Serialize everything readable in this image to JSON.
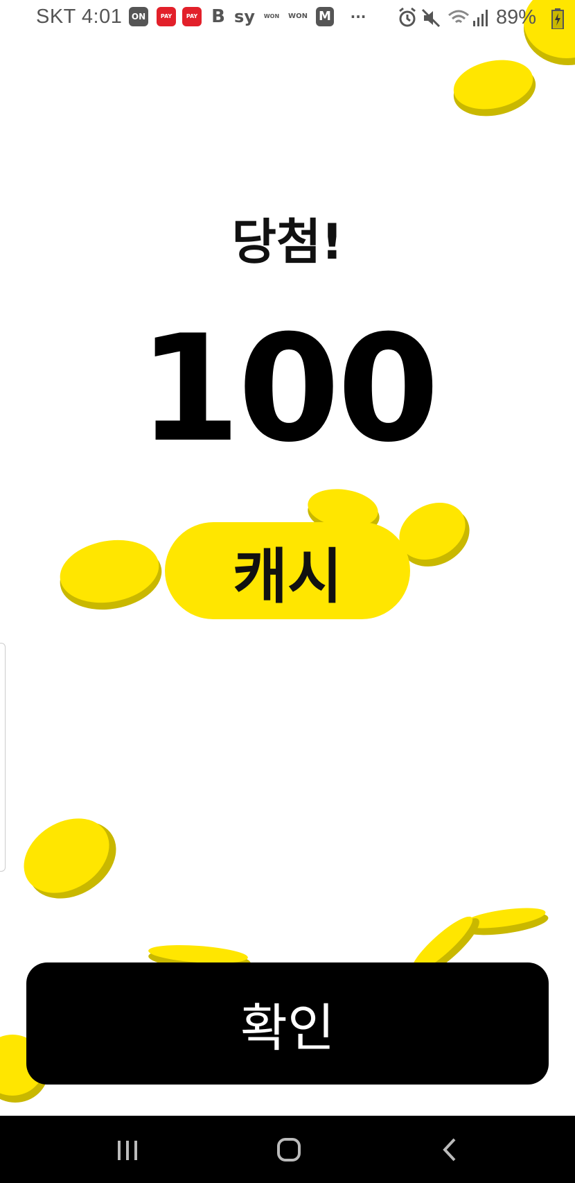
{
  "status_bar": {
    "carrier_time": "SKT 4:01",
    "notification_icons": [
      {
        "name": "on-app-icon",
        "label": "ON",
        "color": "#555555"
      },
      {
        "name": "pay-app-icon",
        "label": "PAY",
        "color": "#e2202a"
      },
      {
        "name": "pay-app-icon-2",
        "label": "PAY",
        "color": "#e2202a"
      },
      {
        "name": "b-app-icon",
        "label": "B",
        "color": "#555555"
      },
      {
        "name": "sy-app-icon",
        "label": "sy",
        "color": "#555555"
      },
      {
        "name": "won-app-icon",
        "label": "WON",
        "color": "#555555"
      },
      {
        "name": "won-app-icon-2",
        "label": "WON",
        "color": "#555555"
      },
      {
        "name": "m-app-icon",
        "label": "M",
        "color": "#555555"
      },
      {
        "name": "more-icon",
        "label": "···",
        "color": "#555555"
      }
    ],
    "battery_percent": "89%"
  },
  "main": {
    "title": "당첨!",
    "amount": "100",
    "unit": "캐시",
    "confirm_label": "확인"
  },
  "colors": {
    "coin_yellow": "#ffe600",
    "coin_shadow": "#c9b800",
    "button": "#000000"
  }
}
